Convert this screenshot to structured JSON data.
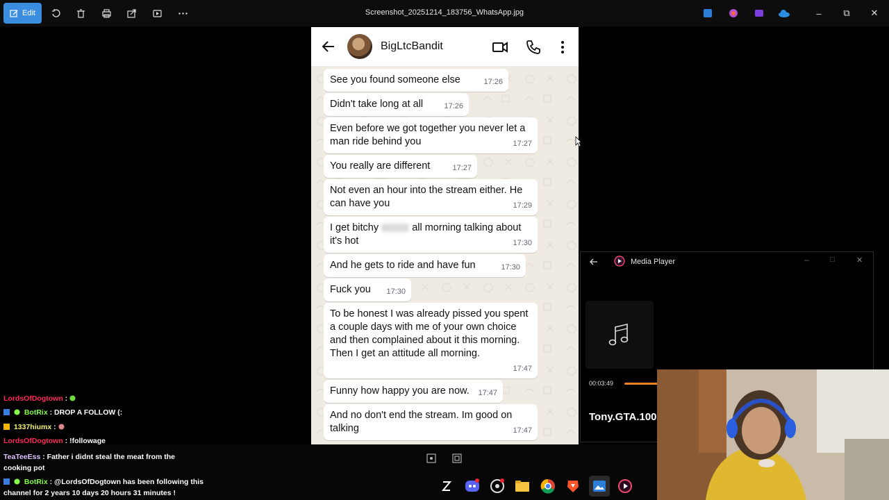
{
  "titlebar": {
    "edit_label": "Edit",
    "file_title": "Screenshot_20251214_183756_WhatsApp.jpg"
  },
  "whatsapp": {
    "contact_name": "BigLtcBandit",
    "messages": [
      {
        "text": "See you found someone else",
        "time": "17:26"
      },
      {
        "text": "Didn't take long at all",
        "time": "17:26"
      },
      {
        "text": "Even before we got together you never let a man ride behind you",
        "time": "17:27"
      },
      {
        "text": "You really are different",
        "time": "17:27"
      },
      {
        "text": "Not even an hour into the stream either. He can have you",
        "time": "17:29"
      },
      {
        "text_before": "I get bitchy",
        "text_after": "all morning talking about it's hot",
        "time": "17:30"
      },
      {
        "text": "And he gets to ride and have fun",
        "time": "17:30"
      },
      {
        "text": "Fuck you",
        "time": "17:30"
      },
      {
        "text": "To be honest I was already pissed you spent a couple days with me of your own choice and then complained about it this morning. Then I get an attitude all morning.",
        "time": "17:47"
      },
      {
        "text": "Funny how happy you are now.",
        "time": "17:47"
      },
      {
        "text": "And no don't end the stream. Im good on talking",
        "time": "17:47"
      }
    ]
  },
  "media_player": {
    "title": "Media Player",
    "elapsed": "00:03:49",
    "track": "Tony.GTA.100",
    "accent": "#f07f1d"
  },
  "chat": {
    "lines": [
      {
        "user": "LordsOfDogtown",
        "message": ""
      },
      {
        "user": "BotRix",
        "message": "DROP A FOLLOW (:"
      },
      {
        "user": "1337hiumx",
        "message": ""
      },
      {
        "user": "LordsOfDogtown",
        "message": "!followage"
      },
      {
        "user": "TeaTeeEss",
        "message": "Father i didnt steal the meat from the cooking pot"
      },
      {
        "user": "BotRix",
        "message": "@LordsOfDogtown has been following this channel for 2 years 10 days 20 hours 31 minutes !"
      }
    ]
  }
}
